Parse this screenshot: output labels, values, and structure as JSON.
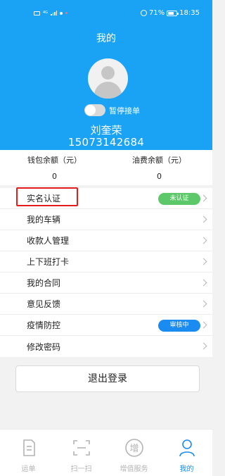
{
  "status_bar": {
    "battery": "71%",
    "time": "18:35",
    "network": "4G"
  },
  "header": {
    "title": "我的"
  },
  "profile": {
    "toggle_label": "暂停接单",
    "name": "刘奎荣",
    "phone": "15073142684"
  },
  "balances": {
    "wallet_label": "钱包余额（元）",
    "wallet_value": "0",
    "fuel_label": "油费余额（元）",
    "fuel_value": "0"
  },
  "menu": {
    "items": [
      {
        "label": "实名认证",
        "badge": "未认证",
        "badge_color": "#5cc86a"
      },
      {
        "label": "我的车辆"
      },
      {
        "label": "收款人管理"
      },
      {
        "label": "上下班打卡"
      },
      {
        "label": "我的合同"
      },
      {
        "label": "意见反馈"
      },
      {
        "label": "疫情防控",
        "badge": "审核中",
        "badge_color": "#1a8bf0"
      },
      {
        "label": "修改密码"
      }
    ]
  },
  "logout": {
    "label": "退出登录"
  },
  "tabbar": {
    "tabs": [
      {
        "label": "运单",
        "icon": "waybill-icon"
      },
      {
        "label": "扫一扫",
        "icon": "scan-icon"
      },
      {
        "label": "增值服务",
        "icon": "value-added-icon",
        "glyph": "增"
      },
      {
        "label": "我的",
        "icon": "profile-icon"
      }
    ],
    "active_color": "#1a8bf0"
  },
  "colors": {
    "header_bg": "#1aa3f5",
    "highlight": "#e51c1c"
  }
}
